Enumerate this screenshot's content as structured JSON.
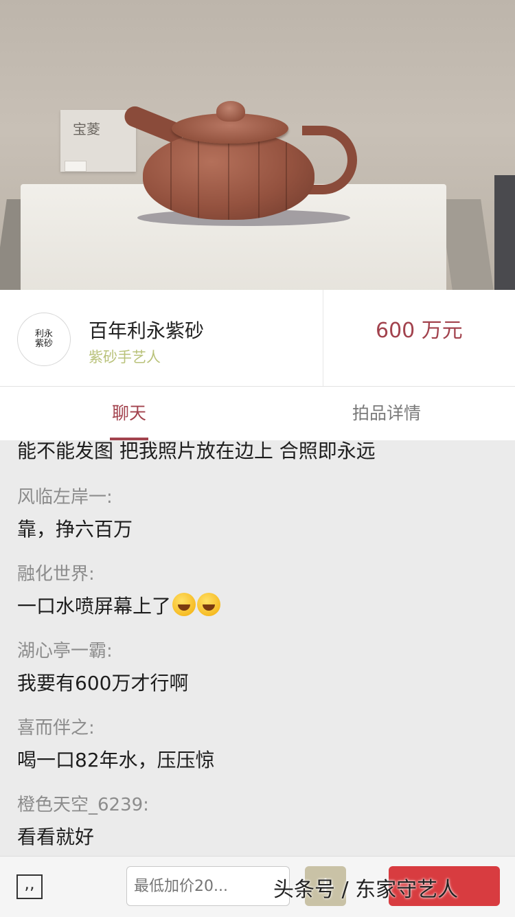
{
  "photo": {
    "plaque_text": "宝菱"
  },
  "seller": {
    "avatar_seal": "利永紫砂",
    "name": "百年利永紫砂",
    "role": "紫砂手艺人",
    "price": "600 万元"
  },
  "tabs": [
    {
      "label": "聊天",
      "active": true
    },
    {
      "label": "拍品详情",
      "active": false
    }
  ],
  "chat": {
    "top_partial": "能不能发图 把我照片放在边上 合照即永远",
    "messages": [
      {
        "user": "风临左岸一:",
        "text": "靠，挣六百万"
      },
      {
        "user": "融化世界:",
        "text": "一口水喷屏幕上了",
        "emoji": [
          "laugh-cry-emoji",
          "laugh-cry-emoji"
        ]
      },
      {
        "user": "湖心亭一霸:",
        "text": "我要有600万才行啊"
      },
      {
        "user": "喜而伴之:",
        "text": "喝一口82年水，压压惊"
      },
      {
        "user": "橙色天空_6239:",
        "text": "看看就好"
      }
    ]
  },
  "bottom_bar": {
    "quote_icon": ",,",
    "bid_placeholder": "最低加价20...",
    "plus_label": "+"
  },
  "watermark": "头条号 / 东家守艺人",
  "colors": {
    "accent": "#a2424d",
    "role_text": "#b9c27a",
    "bid_button": "#d83c40"
  }
}
